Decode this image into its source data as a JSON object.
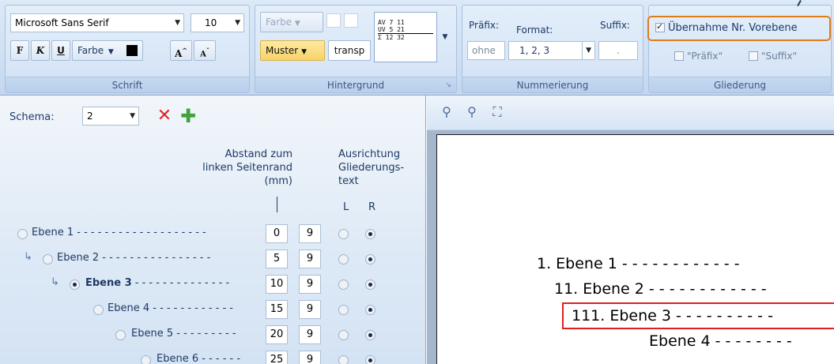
{
  "ribbon": {
    "schrift": {
      "font_name": "Microsoft Sans Serif",
      "font_size": "10",
      "bold": "F",
      "italic": "K",
      "underline": "U",
      "color_label": "Farbe",
      "grow_font": "A",
      "shrink_font": "A",
      "group_label": "Schrift"
    },
    "hintergrund": {
      "farbe_label": "Farbe",
      "muster_label": "Muster",
      "transp_label": "transp",
      "group_label": "Hintergrund",
      "style_preview_lines": [
        "AV   7  11",
        "UV   5  21",
        "Σ   12  32"
      ]
    },
    "nummerierung": {
      "prefix_label": "Präfix:",
      "format_label": "Format:",
      "suffix_label": "Suffix:",
      "prefix_value": "ohne",
      "format_value": "1, 2, 3",
      "suffix_value": ".",
      "group_label": "Nummerierung"
    },
    "gliederung": {
      "uebernahme_label": "Übernahme Nr. Vorebene",
      "uebernahme_checked": true,
      "praefix_label": "\"Präfix\"",
      "suffix_label": "\"Suffix\"",
      "group_label": "Gliederung",
      "highlight_color": "#e07b1a"
    }
  },
  "left_panel": {
    "schema_label": "Schema:",
    "schema_value": "2",
    "abstand_header": [
      "Abstand zum",
      "linken Seitenrand",
      "(mm)"
    ],
    "ausrichtung_header": [
      "Ausrichtung",
      "Gliederungs-",
      "text"
    ],
    "col_l": "L",
    "col_r": "R",
    "levels": [
      {
        "label": "Ebene 1",
        "abstand": "0",
        "width": "9",
        "selected": false,
        "bold": false
      },
      {
        "label": "Ebene 2",
        "abstand": "5",
        "width": "9",
        "selected": false,
        "bold": false
      },
      {
        "label": "Ebene 3",
        "abstand": "10",
        "width": "9",
        "selected": true,
        "bold": true
      },
      {
        "label": "Ebene 4",
        "abstand": "15",
        "width": "9",
        "selected": false,
        "bold": false
      },
      {
        "label": "Ebene 5",
        "abstand": "20",
        "width": "9",
        "selected": false,
        "bold": false
      },
      {
        "label": "Ebene 6",
        "abstand": "25",
        "width": "9",
        "selected": false,
        "bold": false
      }
    ]
  },
  "preview": {
    "lines": [
      "1. Ebene 1",
      "11. Ebene 2",
      "111. Ebene 3",
      "Ebene 4"
    ],
    "highlight_color": "#e02020"
  }
}
